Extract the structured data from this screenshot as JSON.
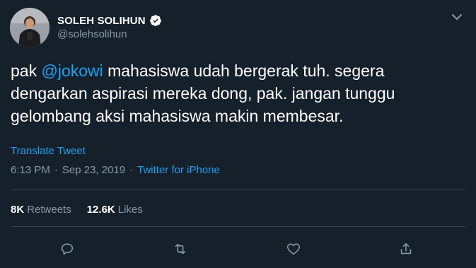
{
  "user": {
    "display_name": "SOLEH SOLIHUN",
    "handle": "@solehsolihun",
    "verified_icon": "verified-badge-icon",
    "avatar_icon": "avatar"
  },
  "tweet": {
    "text_before_mention": "pak ",
    "mention": "@jokowi",
    "text_after_mention": " mahasiswa udah bergerak tuh. segera\ndengarkan aspirasi mereka dong, pak. jangan tunggu\ngelombang aksi mahasiswa makin membesar."
  },
  "translate_label": "Translate Tweet",
  "meta": {
    "time": "6:13 PM",
    "separator": "·",
    "date": "Sep 23, 2019",
    "separator2": "·",
    "source": "Twitter for iPhone"
  },
  "stats": {
    "retweets_count": "8K",
    "retweets_label": "Retweets",
    "likes_count": "12.6K",
    "likes_label": "Likes"
  },
  "actions": {
    "reply_icon": "reply-icon",
    "retweet_icon": "retweet-icon",
    "like_icon": "heart-icon",
    "share_icon": "share-icon",
    "menu_icon": "chevron-down-icon"
  },
  "colors": {
    "background": "#15202b",
    "accent": "#1da1f2",
    "secondary_text": "#8899a6",
    "divider": "#38444d"
  }
}
